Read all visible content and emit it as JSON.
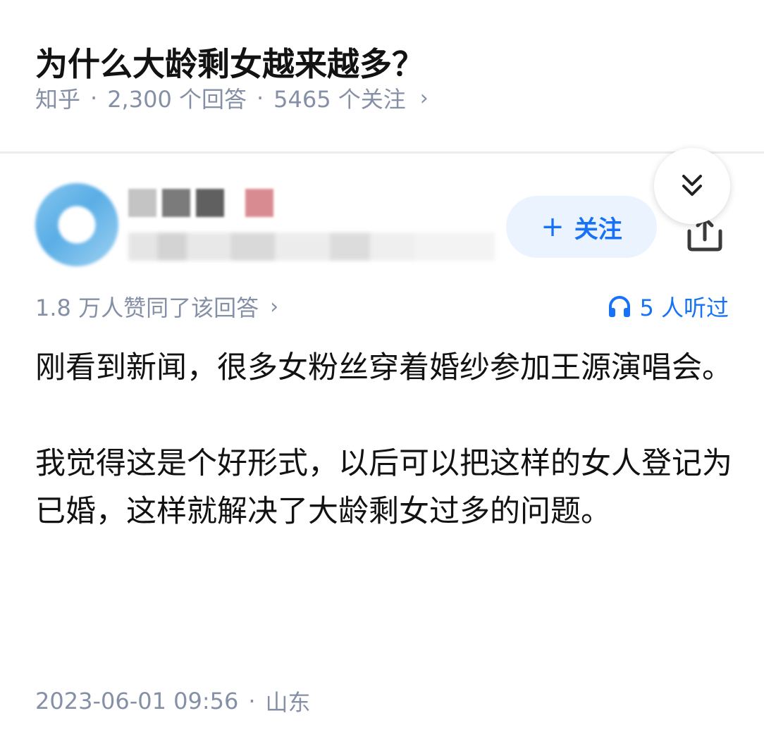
{
  "question": {
    "title": "为什么大龄剩女越来越多？",
    "source": "知乎",
    "answers": "2,300 个回答",
    "followers": "5465 个关注",
    "separator": "·",
    "chevron": "›"
  },
  "author": {
    "follow_plus": "+",
    "follow_label": "关注"
  },
  "answer": {
    "votes": "1.8 万人赞同了该回答",
    "votes_chevron": "›",
    "listen_label": "5 人听过",
    "paragraphs": [
      "刚看到新闻，很多女粉丝穿着婚纱参加王源演唱会。",
      "我觉得这是个好形式，以后可以把这样的女人登记为已婚，这样就解决了大龄剩女过多的问题。"
    ],
    "date": "2023-06-01 09:56",
    "location": "山东",
    "separator": "·"
  },
  "icons": {
    "share": "share-icon",
    "collapse": "chevron-double-down-icon",
    "headphones": "headphones-icon"
  },
  "colors": {
    "accent": "#1772f6",
    "accent_bg": "#ebf3ff",
    "meta_text": "#8590a6",
    "body_text": "#121212"
  }
}
